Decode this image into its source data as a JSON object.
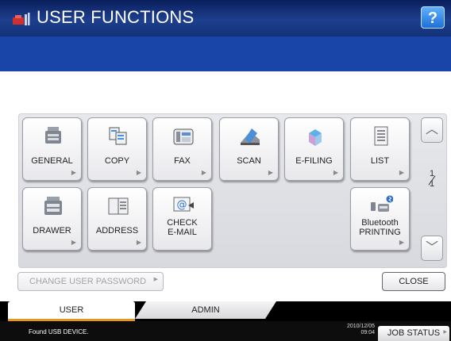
{
  "header": {
    "title": "USER FUNCTIONS",
    "help_label": "?"
  },
  "functions": [
    {
      "label": "GENERAL",
      "icon": "general-icon"
    },
    {
      "label": "COPY",
      "icon": "copy-icon"
    },
    {
      "label": "FAX",
      "icon": "fax-icon"
    },
    {
      "label": "SCAN",
      "icon": "scan-icon"
    },
    {
      "label": "E-FILING",
      "icon": "efiling-icon"
    },
    {
      "label": "LIST",
      "icon": "list-icon"
    },
    {
      "label": "DRAWER",
      "icon": "drawer-icon"
    },
    {
      "label": "ADDRESS",
      "icon": "address-icon"
    },
    {
      "label_line1": "CHECK",
      "label_line2": "E-MAIL",
      "icon": "check-email-icon"
    },
    {
      "label_line1": "Bluetooth",
      "label_line2": "PRINTING",
      "icon": "bluetooth-printing-icon"
    }
  ],
  "pagination": {
    "current": "1",
    "total": "1"
  },
  "buttons": {
    "change_password": "CHANGE USER PASSWORD",
    "close": "CLOSE"
  },
  "tabs": [
    {
      "label": "USER",
      "active": true
    },
    {
      "label": "ADMIN",
      "active": false
    }
  ],
  "status": {
    "message": "Found USB DEVICE.",
    "date": "2010/12/05",
    "time": "09:04",
    "job_status": "JOB STATUS"
  },
  "colors": {
    "title_bar": "#1e3f8e",
    "accent_tab": "#e39a1c",
    "help_button": "#1d6fd8"
  }
}
